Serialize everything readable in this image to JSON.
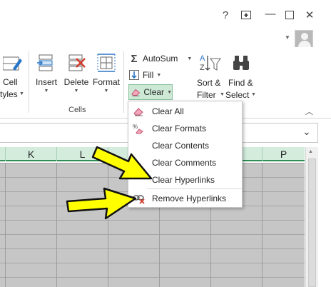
{
  "titlebar": {
    "help_label": "?",
    "ribbon_display_icon": "ribbon-display-icon",
    "minimize_label": "—",
    "maximize_icon": "maximize-icon",
    "close_label": "✕"
  },
  "ribbon": {
    "cell_styles_line1": "Cell",
    "cell_styles_line2": "tyles",
    "insert_label": "Insert",
    "delete_label": "Delete",
    "format_label": "Format",
    "cells_group_label": "Cells",
    "autosum_label": "AutoSum",
    "fill_label": "Fill",
    "clear_label": "Clear",
    "sort_filter_line1": "Sort &",
    "sort_filter_line2": "Filter",
    "find_select_line1": "Find &",
    "find_select_line2": "Select"
  },
  "columns": [
    "K",
    "L",
    "P"
  ],
  "clear_menu": {
    "items": [
      {
        "label": "Clear All",
        "icon": "eraser-icon"
      },
      {
        "label": "Clear Formats",
        "icon": "percent-eraser-icon"
      },
      {
        "label": "Clear Contents",
        "icon": ""
      },
      {
        "label": "Clear Comments",
        "icon": ""
      },
      {
        "label": "Clear Hyperlinks",
        "icon": ""
      },
      {
        "label": "Remove Hyperlinks",
        "icon": "remove-link-icon"
      }
    ]
  },
  "colors": {
    "accent_green": "#2f8d55",
    "header_green": "#d3ecdc",
    "arrow_yellow": "#ffff00",
    "clear_highlight": "#cde9d6"
  }
}
